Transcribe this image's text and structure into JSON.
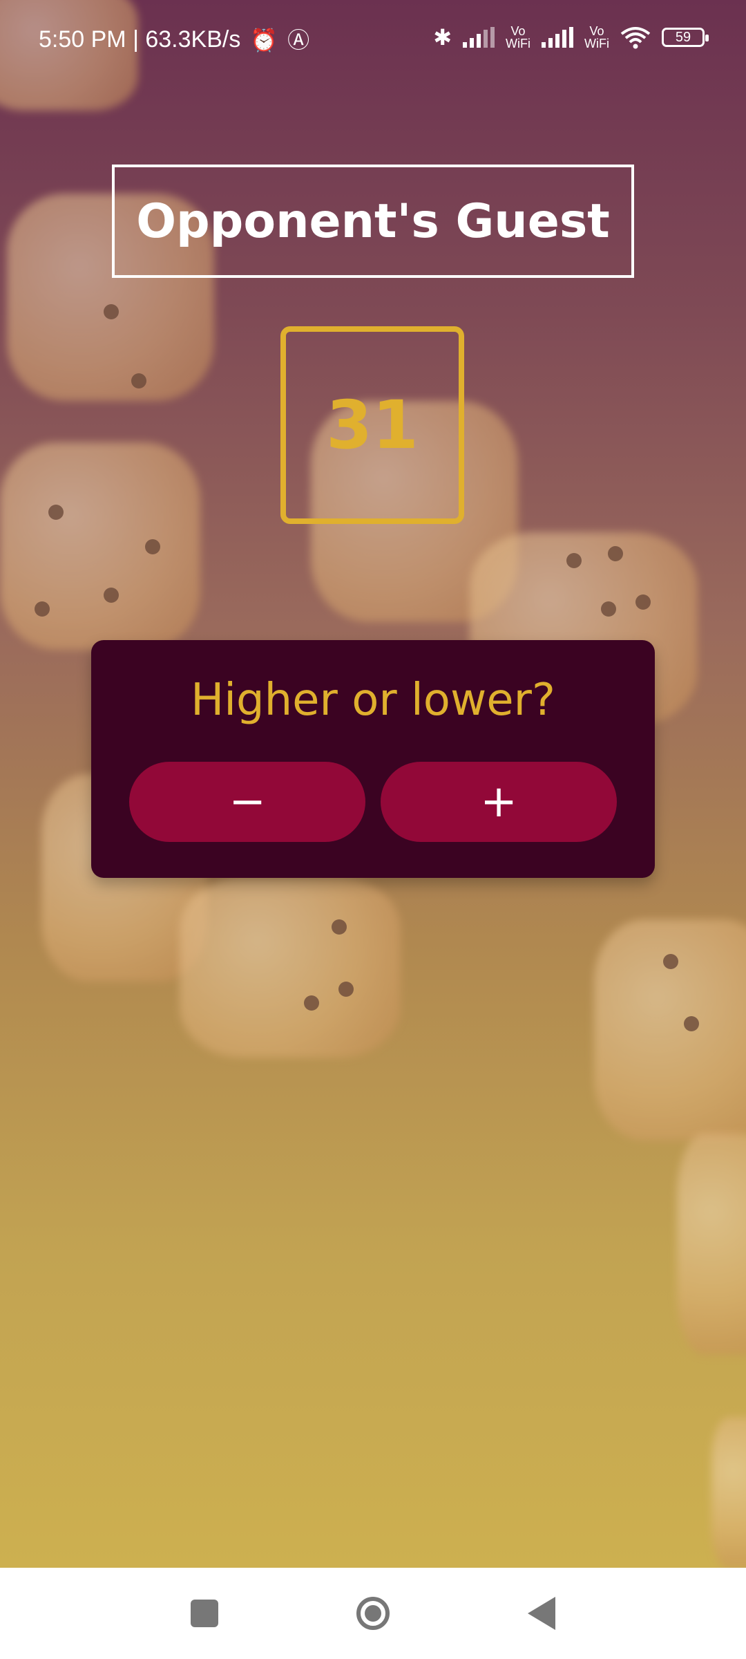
{
  "status_bar": {
    "time_speed": "5:50 PM | 63.3KB/s",
    "icons": [
      "alarm-icon",
      "app-icon",
      "bluetooth-icon",
      "signal-icon",
      "vowifi-icon",
      "signal-icon",
      "vowifi-icon",
      "wifi-icon"
    ],
    "vowifi_label": "Vo\nWiFi",
    "battery_level": "59"
  },
  "game": {
    "player_name": "Opponent's Guest",
    "current_number": "31",
    "question": "Higher or lower?",
    "lower_label": "−",
    "higher_label": "+"
  },
  "colors": {
    "accent_gold": "#e0b02e",
    "panel_bg": "#3b0322",
    "button_bg": "#920838"
  },
  "nav_bar": {
    "buttons": [
      "recent-apps",
      "home",
      "back"
    ]
  }
}
